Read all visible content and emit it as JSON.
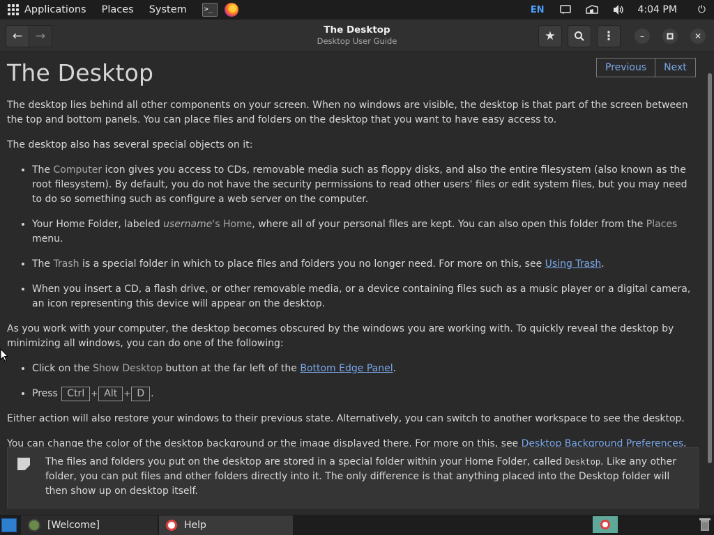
{
  "top_panel": {
    "applications": "Applications",
    "places": "Places",
    "system": "System",
    "terminal_glyph": ">_",
    "lang": "EN",
    "clock": "4:04 PM",
    "power_glyph": "⏻"
  },
  "header": {
    "title": "The Desktop",
    "subtitle": "Desktop User Guide",
    "back": "←",
    "forward": "→",
    "bookmark": "★",
    "search": "🔍",
    "menu": "⋮",
    "minimize": "–",
    "maximize": "▫",
    "close": "✕"
  },
  "page": {
    "heading": "The Desktop",
    "previous": "Previous",
    "next": "Next",
    "p1": "The desktop lies behind all other components on your screen. When no windows are visible, the desktop is that part of the screen between the top and bottom panels. You can place files and folders on the desktop that you want to have easy access to.",
    "p2": "The desktop also has several special objects on it:",
    "li1_a": "The ",
    "li1_gui": "Computer",
    "li1_b": " icon gives you access to CDs, removable media such as floppy disks, and also the entire filesystem (also known as the root filesystem). By default, you do not have the security permissions to read other users' files or edit system files, but you may need to do so something such as configure a web server on the computer.",
    "li2_a": "Your Home Folder, labeled ",
    "li2_emph": "username",
    "li2_gui": "'s Home",
    "li2_b": ", where all of your personal files are kept. You can also open this folder from the ",
    "li2_gui2": "Places",
    "li2_c": " menu.",
    "li3_a": "The ",
    "li3_gui": "Trash",
    "li3_b": " is a special folder in which to place files and folders you no longer need. For more on this, see ",
    "li3_link": "Using Trash",
    "li3_c": ".",
    "li4": "When you insert a CD, a flash drive, or other removable media, or a device containing files such as a music player or a digital camera, an icon representing this device will appear on the desktop.",
    "p3": "As you work with your computer, the desktop becomes obscured by the windows you are working with. To quickly reveal the desktop by minimizing all windows, you can do one of the following:",
    "li5_a": "Click on the ",
    "li5_gui": "Show Desktop",
    "li5_b": " button at the far left of the ",
    "li5_link": "Bottom Edge Panel",
    "li5_c": ".",
    "li6_a": "Press ",
    "key1": "Ctrl",
    "key2": "Alt",
    "key3": "D",
    "plus": "+",
    "li6_c": ".",
    "p4": "Either action will also restore your windows to their previous state. Alternatively, you can switch to another workspace to see the desktop.",
    "p5_a": "You can change the color of the desktop background or the image displayed there. For more on this, see ",
    "p5_link": "Desktop Background Preferences",
    "p5_c": ".",
    "note_a": "The files and folders you put on the desktop are stored in a special folder within your Home Folder, called ",
    "note_mono": "Desktop",
    "note_b": ". Like any other folder, you can put files and other folders directly into it. The only difference is that anything placed into the Desktop folder will then show up on desktop itself."
  },
  "taskbar": {
    "welcome": "[Welcome]",
    "help": "Help"
  },
  "colors": {
    "accent": "#7aa7e8",
    "lang": "#4ea0ff",
    "workspace": "#5fa89a"
  }
}
